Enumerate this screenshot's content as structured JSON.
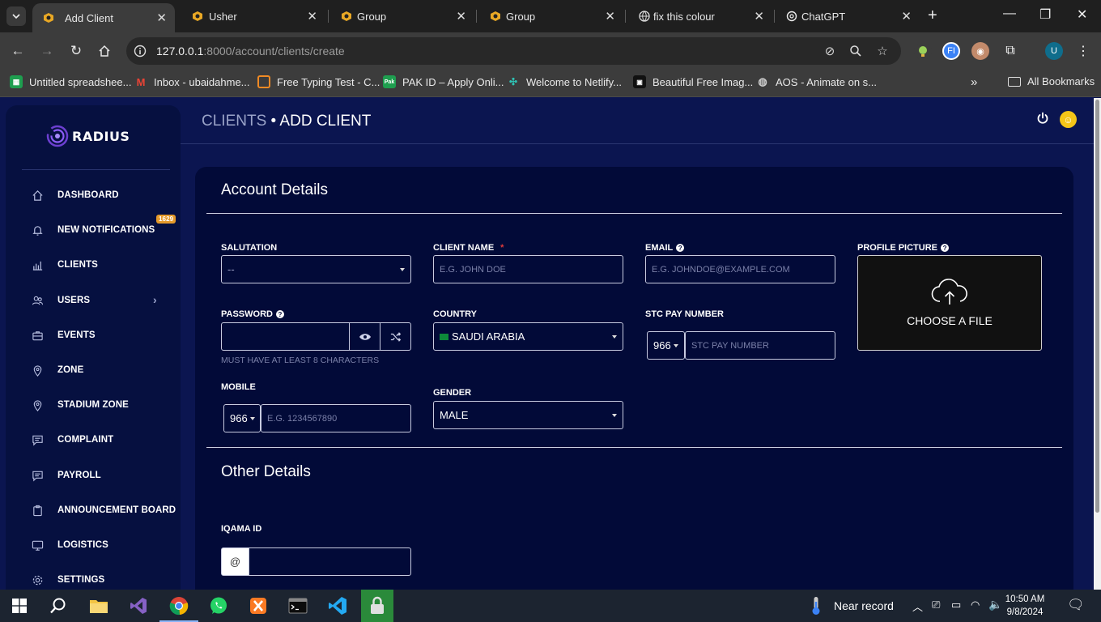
{
  "browser": {
    "tabs": [
      {
        "title": "Add Client",
        "active": true
      },
      {
        "title": "Usher"
      },
      {
        "title": "Group"
      },
      {
        "title": "Group"
      },
      {
        "title": "fix this colour"
      },
      {
        "title": "ChatGPT"
      }
    ],
    "url_host": "127.0.0.1",
    "url_rest": ":8000/account/clients/create",
    "profile_initial": "U",
    "bookmarks": [
      "Untitled spreadshee...",
      "Inbox - ubaidahme...",
      "Free Typing Test - C...",
      "PAK ID – Apply Onli...",
      "Welcome to Netlify...",
      "Beautiful Free Imag...",
      "AOS - Animate on s..."
    ],
    "all_bookmarks": "All Bookmarks",
    "colors": {
      "chrome_dark": "#1f1f1f",
      "chrome_toolbar": "#3c3c3c"
    }
  },
  "app": {
    "brand": "RADIUS",
    "breadcrumb_parent": "CLIENTS",
    "breadcrumb_sep": " • ",
    "breadcrumb_current": "ADD CLIENT",
    "colors": {
      "background": "#0b1550",
      "sidebar": "#061040",
      "card": "#020a38",
      "required": "#e03a3a",
      "badge": "#e59a2a"
    },
    "nav": [
      {
        "label": "DASHBOARD",
        "icon": "home-icon"
      },
      {
        "label": "NEW NOTIFICATIONS",
        "icon": "bell-icon",
        "badge": "1629"
      },
      {
        "label": "CLIENTS",
        "icon": "chart-icon"
      },
      {
        "label": "USERS",
        "icon": "users-icon",
        "has_submenu": true
      },
      {
        "label": "EVENTS",
        "icon": "briefcase-icon"
      },
      {
        "label": "ZONE",
        "icon": "map-pin-icon"
      },
      {
        "label": "STADIUM ZONE",
        "icon": "map-pin-icon"
      },
      {
        "label": "COMPLAINT",
        "icon": "message-icon"
      },
      {
        "label": "PAYROLL",
        "icon": "message-icon"
      },
      {
        "label": "ANNOUNCEMENT BOARD",
        "icon": "clipboard-icon"
      },
      {
        "label": "LOGISTICS",
        "icon": "monitor-icon"
      },
      {
        "label": "SETTINGS",
        "icon": "gear-icon"
      }
    ]
  },
  "form": {
    "account_title": "Account Details",
    "other_title": "Other Details",
    "salutation": {
      "label": "SALUTATION",
      "value": "--"
    },
    "client_name": {
      "label": "CLIENT NAME",
      "required": "*",
      "placeholder": "E.G. JOHN DOE"
    },
    "email": {
      "label": "EMAIL",
      "placeholder": "E.G. JOHNDOE@EXAMPLE.COM"
    },
    "profile_picture": {
      "label": "PROFILE PICTURE",
      "button": "CHOOSE A FILE"
    },
    "password": {
      "label": "PASSWORD",
      "hint": "MUST HAVE AT LEAST 8 CHARACTERS"
    },
    "country": {
      "label": "COUNTRY",
      "value": "SAUDI ARABIA"
    },
    "stc": {
      "label": "STC PAY NUMBER",
      "code": "966",
      "placeholder": "STC PAY NUMBER"
    },
    "mobile": {
      "label": "MOBILE",
      "code": "966",
      "placeholder": "E.G. 1234567890"
    },
    "gender": {
      "label": "GENDER",
      "value": "MALE"
    },
    "iqama": {
      "label": "IQAMA ID",
      "prefix": "@"
    }
  },
  "taskbar": {
    "weather": "Near record",
    "time": "10:50 AM",
    "date": "9/8/2024"
  }
}
